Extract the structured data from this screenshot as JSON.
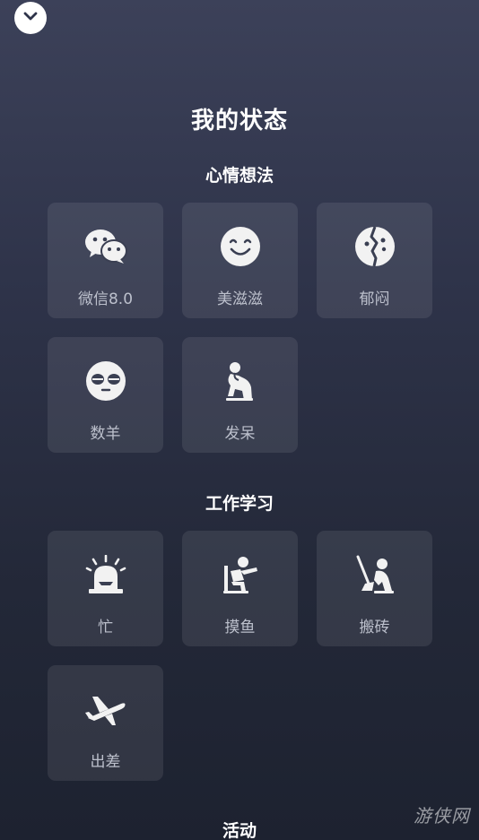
{
  "page_title": "我的状态",
  "sections": [
    {
      "title": "心情想法",
      "items": [
        {
          "label": "微信8.0",
          "icon": "wechat-icon"
        },
        {
          "label": "美滋滋",
          "icon": "smile-face-icon"
        },
        {
          "label": "郁闷",
          "icon": "cracked-face-icon"
        },
        {
          "label": "数羊",
          "icon": "sleepy-face-icon"
        },
        {
          "label": "发呆",
          "icon": "thinker-icon"
        }
      ]
    },
    {
      "title": "工作学习",
      "items": [
        {
          "label": "忙",
          "icon": "siren-icon"
        },
        {
          "label": "摸鱼",
          "icon": "slacking-icon"
        },
        {
          "label": "搬砖",
          "icon": "shovel-worker-icon"
        },
        {
          "label": "出差",
          "icon": "airplane-icon"
        }
      ]
    },
    {
      "title": "活动",
      "items": []
    }
  ],
  "watermark": "游侠网",
  "colors": {
    "background_top": "#3c4159",
    "background_bottom": "#1d2230",
    "tile_background": "rgba(255,255,255,0.085)",
    "label_color": "#bcc0cc"
  }
}
